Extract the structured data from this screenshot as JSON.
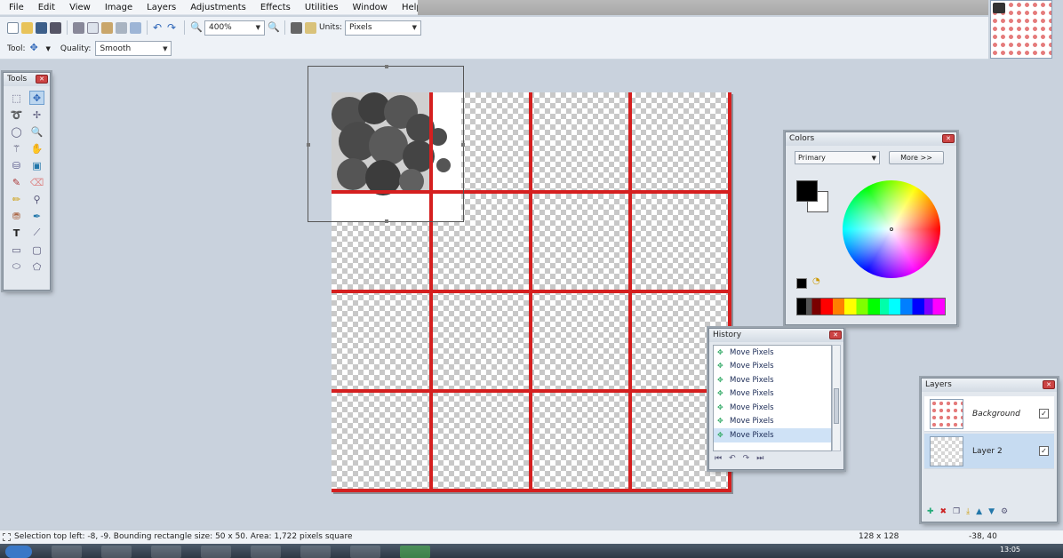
{
  "menu": [
    "File",
    "Edit",
    "View",
    "Image",
    "Layers",
    "Adjustments",
    "Effects",
    "Utilities",
    "Window",
    "Help"
  ],
  "toolbar": {
    "zoom_value": "400%",
    "units_label": "Units:",
    "units_value": "Pixels",
    "tool_label": "Tool:",
    "quality_label": "Quality:",
    "quality_value": "Smooth"
  },
  "tools_panel": {
    "title": "Tools"
  },
  "colors_panel": {
    "title": "Colors",
    "mode": "Primary",
    "more_button": "More >>"
  },
  "history_panel": {
    "title": "History",
    "items": [
      "Move Pixels",
      "Move Pixels",
      "Move Pixels",
      "Move Pixels",
      "Move Pixels",
      "Move Pixels",
      "Move Pixels"
    ]
  },
  "layers_panel": {
    "title": "Layers",
    "layers": [
      {
        "name": "Background",
        "visible": true,
        "selected": false
      },
      {
        "name": "Layer 2",
        "visible": true,
        "selected": true
      }
    ]
  },
  "status": {
    "selection": "Selection top left: -8, -9. Bounding rectangle size: 50 x 50. Area: 1,722 pixels square",
    "image_size": "128 x 128",
    "cursor": "-38, 40"
  },
  "taskbar": {
    "clock": "13:05"
  },
  "colors": {
    "accent": "#cc2222",
    "primary": "#000000",
    "secondary": "#ffffff"
  }
}
